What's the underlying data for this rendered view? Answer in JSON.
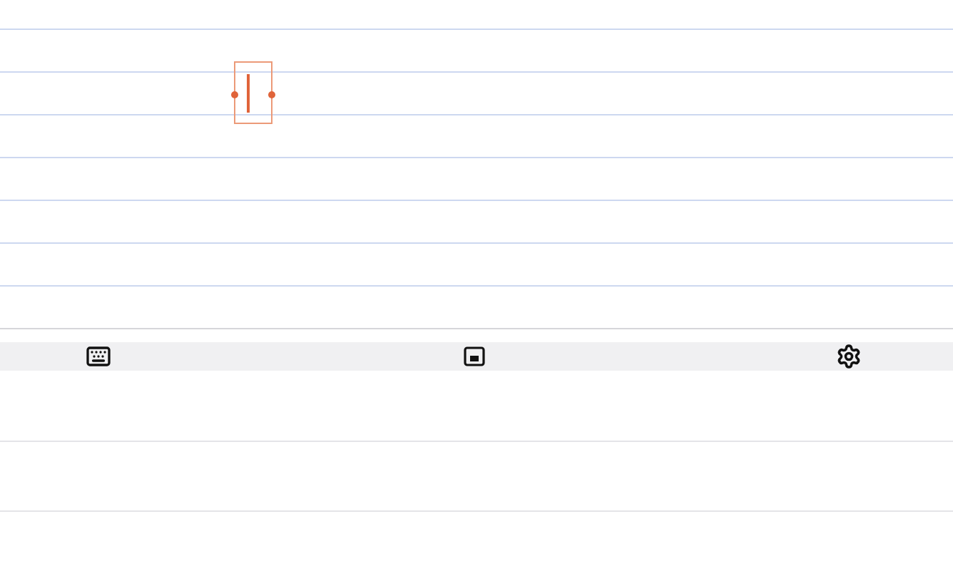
{
  "editor": {
    "cursor": {
      "kind": "selection"
    }
  },
  "toolbar": {
    "buttons": [
      {
        "kind": "keyboard"
      },
      {
        "kind": "minimize"
      },
      {
        "kind": "settings"
      }
    ]
  }
}
